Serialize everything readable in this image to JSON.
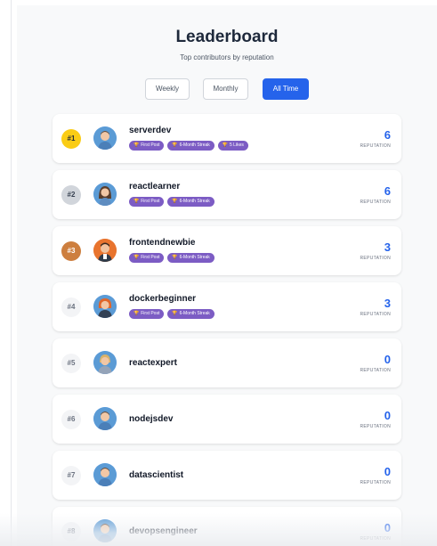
{
  "header": {
    "title": "Leaderboard",
    "subtitle": "Top contributors by reputation"
  },
  "tabs": [
    {
      "label": "Weekly",
      "active": false
    },
    {
      "label": "Monthly",
      "active": false
    },
    {
      "label": "All Time",
      "active": true
    }
  ],
  "colors": {
    "accent": "#2563eb",
    "badge": "#7c5cc4",
    "gold": "#facc15",
    "silver": "#d1d5db",
    "bronze": "#cd7f3f"
  },
  "reputation_label": "REPUTATION",
  "entries": [
    {
      "rank": "#1",
      "username": "serverdev",
      "reputation": "6",
      "avatar": "avatar-blue-man-icon",
      "badges": [
        "First Post",
        "6-Month Streak",
        "5 Likes"
      ]
    },
    {
      "rank": "#2",
      "username": "reactlearner",
      "reputation": "6",
      "avatar": "avatar-woman-icon",
      "badges": [
        "First Post",
        "6-Month Streak"
      ]
    },
    {
      "rank": "#3",
      "username": "frontendnewbie",
      "reputation": "3",
      "avatar": "avatar-orange-man-icon",
      "badges": [
        "First Post",
        "6-Month Streak"
      ]
    },
    {
      "rank": "#4",
      "username": "dockerbeginner",
      "reputation": "3",
      "avatar": "avatar-redhead-icon",
      "badges": [
        "First Post",
        "6-Month Streak"
      ]
    },
    {
      "rank": "#5",
      "username": "reactexpert",
      "reputation": "0",
      "avatar": "avatar-blonde-icon",
      "badges": []
    },
    {
      "rank": "#6",
      "username": "nodejsdev",
      "reputation": "0",
      "avatar": "avatar-blue-man-icon",
      "badges": []
    },
    {
      "rank": "#7",
      "username": "datascientist",
      "reputation": "0",
      "avatar": "avatar-blue-man-icon",
      "badges": []
    },
    {
      "rank": "#8",
      "username": "devopsengineer",
      "reputation": "0",
      "avatar": "avatar-blue-man-icon",
      "badges": []
    }
  ]
}
